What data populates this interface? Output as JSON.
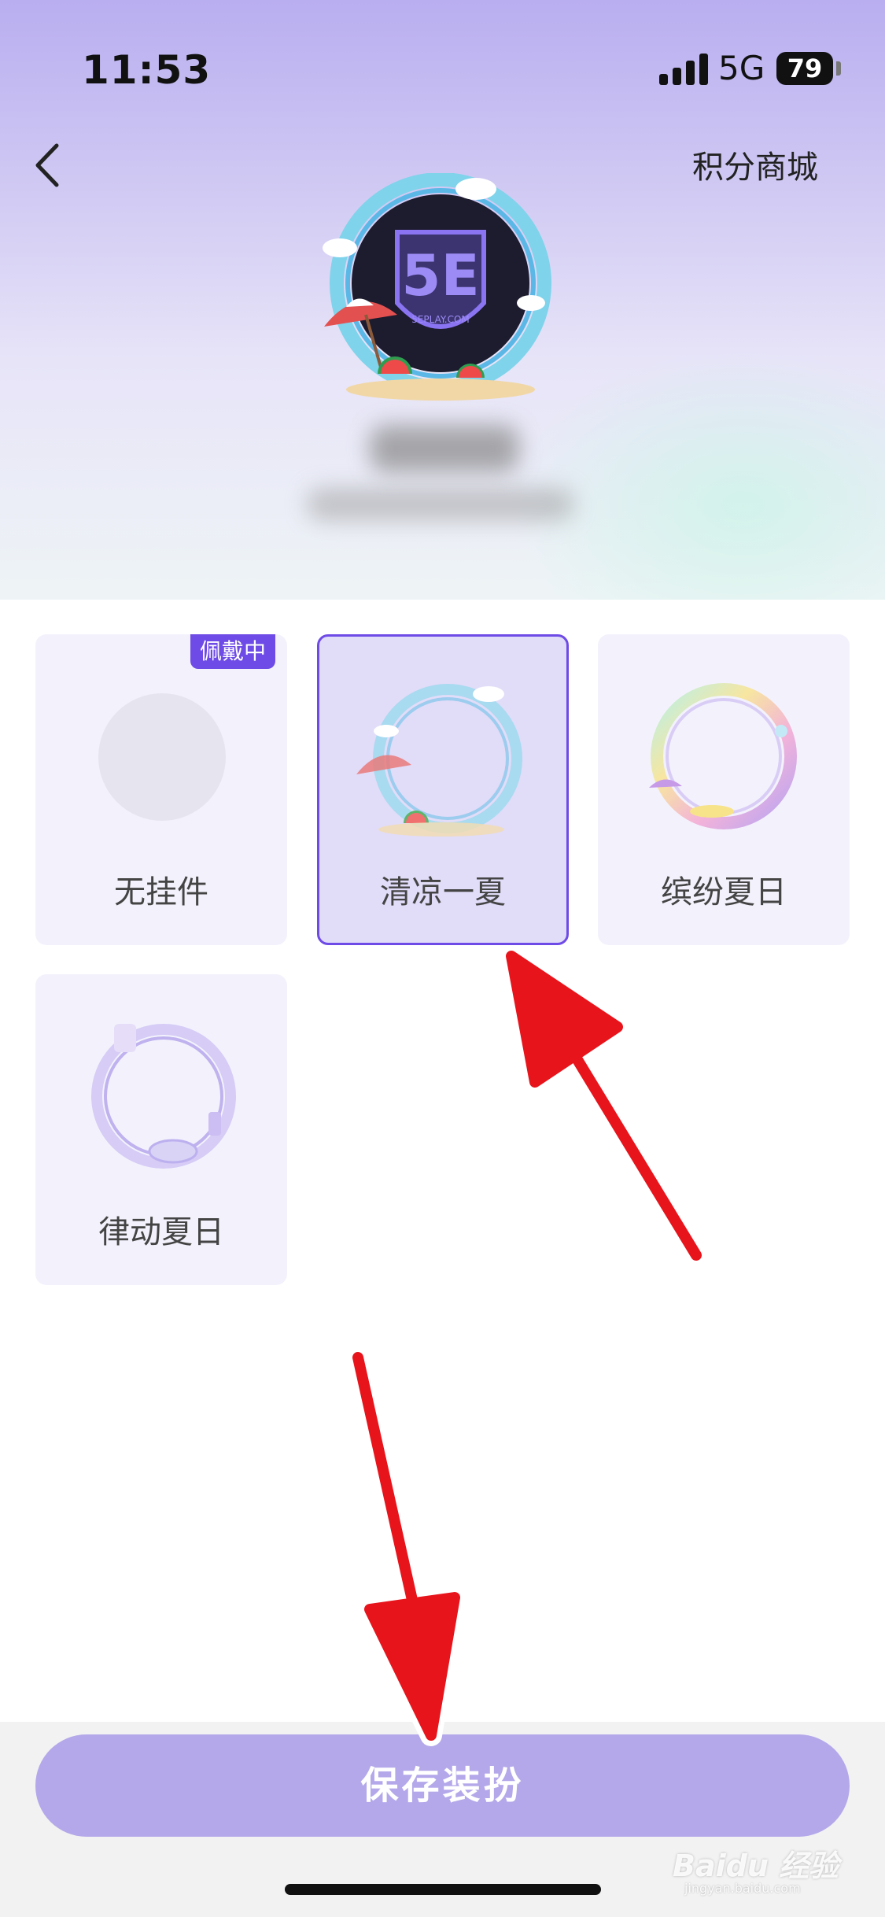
{
  "status_bar": {
    "time": "11:53",
    "network": "5G",
    "battery": "79"
  },
  "header": {
    "mall_label": "积分商城",
    "avatar_logo_text": "5E",
    "avatar_logo_sub": "5EPLAY.COM"
  },
  "pendants": [
    {
      "label": "无挂件",
      "badge": "佩戴中",
      "selected": false
    },
    {
      "label": "清凉一夏",
      "selected": true
    },
    {
      "label": "缤纷夏日",
      "selected": false
    },
    {
      "label": "律动夏日",
      "selected": false
    }
  ],
  "footer": {
    "save_label": "保存装扮"
  },
  "watermark": {
    "brand": "Baidu 经验",
    "url": "jingyan.baidu.com"
  },
  "colors": {
    "accent": "#6e4be6",
    "button": "#b4a8ea",
    "annotation_arrow": "#e8141c"
  }
}
